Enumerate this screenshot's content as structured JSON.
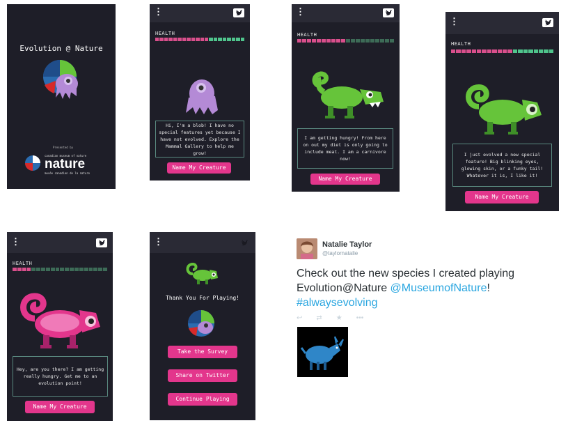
{
  "splash": {
    "title": "Evolution @ Nature",
    "presented_by": "Presented by",
    "museum_line1": "canadian museum of nature",
    "museum_name": "nature",
    "museum_line2": "musée canadien de la nature"
  },
  "common": {
    "health_label": "HEALTH",
    "name_button": "Name My Creature"
  },
  "screens": [
    {
      "message": "Hi, I'm a blob! I have no special features yet because I have not evolved. Explore the Mammal Gallery to help me grow!"
    },
    {
      "message": "I am getting hungry! From here on out my diet is only going to include meat. I am a carnivore now!"
    },
    {
      "message": "I just evolved a new special feature! Big blinking eyes, glowing skin, or a funky tail! Whatever it is, I like it!"
    },
    {
      "message": "Hey, are you there? I am getting really hungry. Get me to an evolution point!"
    }
  ],
  "health": {
    "full_color": "#d94f8c",
    "empty_color": "#3d6b57",
    "accent_color": "#4fc48c",
    "levels": [
      1.0,
      0.5,
      1.0,
      0.2
    ]
  },
  "thanks": {
    "title": "Thank You For Playing!",
    "buttons": [
      "Take the Survey",
      "Share on Twitter",
      "Continue Playing"
    ]
  },
  "tweet": {
    "name": "Natalie Taylor",
    "handle": "@taylornatalie",
    "text_prefix": "Check out the new species I created playing Evolution@Nature ",
    "mention": "@MuseumofNature",
    "text_suffix": "!",
    "hashtag": "#alwaysevolving",
    "actions": [
      "reply-icon",
      "retweet-icon",
      "favorite-icon",
      "more-icon"
    ]
  },
  "colors": {
    "phone_bg": "#1e1e28",
    "pink": "#e3368c",
    "green": "#66c43a",
    "purple": "#b48ad6",
    "link": "#2aa6e0"
  }
}
